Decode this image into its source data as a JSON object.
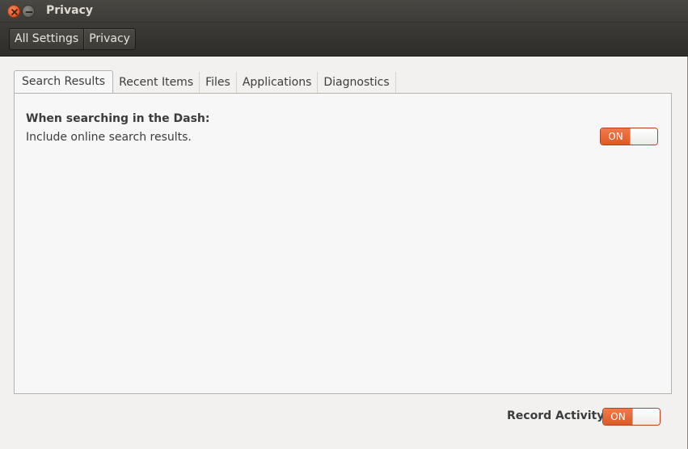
{
  "window": {
    "title": "Privacy"
  },
  "toolbar": {
    "breadcrumb": [
      "All Settings",
      "Privacy"
    ]
  },
  "tabs": [
    {
      "label": "Search Results",
      "active": true
    },
    {
      "label": "Recent Items",
      "active": false
    },
    {
      "label": "Files",
      "active": false
    },
    {
      "label": "Applications",
      "active": false
    },
    {
      "label": "Diagnostics",
      "active": false
    }
  ],
  "search_results": {
    "heading": "When searching in the Dash:",
    "description": "Include online search results.",
    "toggle_label": "ON"
  },
  "footer": {
    "record_activity_label": "Record Activity",
    "toggle_label": "ON"
  },
  "colors": {
    "accent": "#df5a24",
    "titlebar": "#3c3b37",
    "background": "#f2f1f0"
  },
  "icons": {
    "close": "close-icon",
    "minimize": "minimize-icon"
  }
}
